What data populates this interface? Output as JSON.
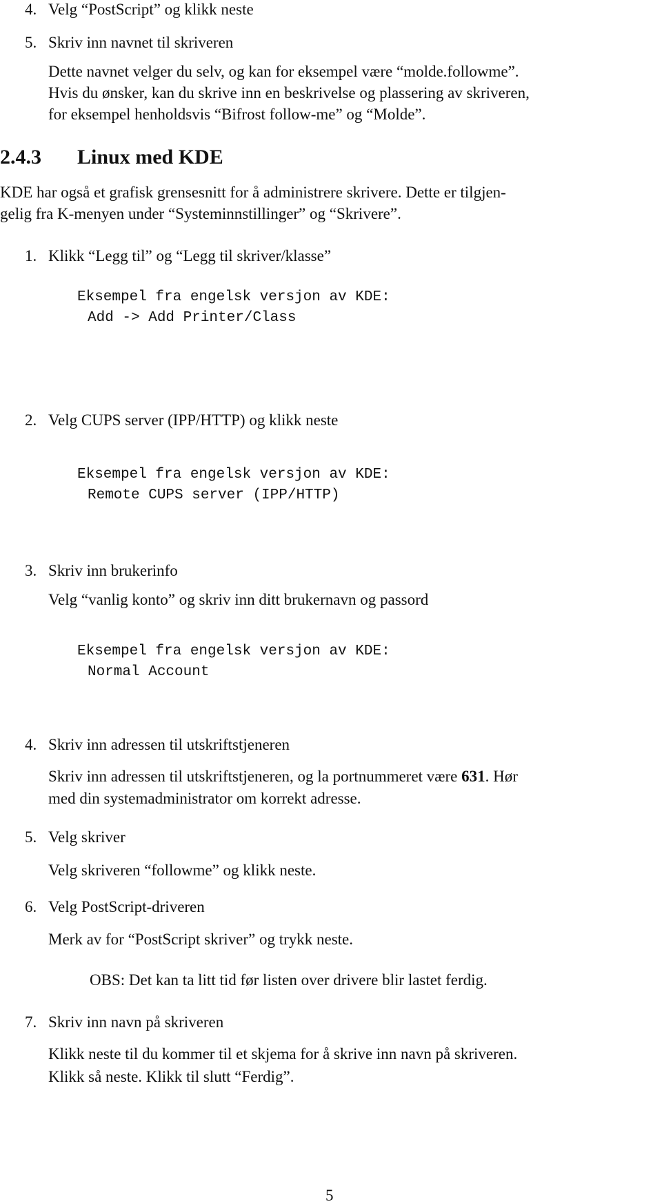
{
  "prev_list": [
    {
      "number": "4.",
      "title": "Velg “PostScript” og klikk neste"
    },
    {
      "number": "5.",
      "title": "Skriv inn navnet til skriveren",
      "body": [
        "Dette navnet velger du selv, og kan for eksempel være “molde.followme”.",
        "Hvis du ønsker, kan du skrive inn en beskrivelse og plassering av skriveren,",
        "for eksempel henholdsvis “Bifrost follow-me” og “Molde”."
      ]
    }
  ],
  "section": {
    "number": "2.4.3",
    "title": "Linux med KDE",
    "intro": [
      "KDE har også et grafisk grensesnitt for å administrere skrivere. Dette er tilgjen-",
      "gelig fra K-menyen under “Systeminnstillinger” og “Skrivere”."
    ]
  },
  "steps": [
    {
      "number": "1.",
      "title": "Klikk “Legg til” og “Legg til skriver/klasse”",
      "example_label": "Eksempel fra engelsk versjon av KDE:",
      "example_value": "Add -> Add Printer/Class"
    },
    {
      "number": "2.",
      "title": "Velg CUPS server (IPP/HTTP) og klikk neste",
      "example_label": "Eksempel fra engelsk versjon av KDE:",
      "example_value": "Remote CUPS server (IPP/HTTP)"
    },
    {
      "number": "3.",
      "title": "Skriv inn brukerinfo",
      "body": [
        "Velg “vanlig konto” og skriv inn ditt brukernavn og passord"
      ],
      "example_label": "Eksempel fra engelsk versjon av KDE:",
      "example_value": "Normal Account"
    },
    {
      "number": "4.",
      "title": "Skriv inn adressen til utskriftstjeneren",
      "body_line1_pre": "Skriv inn adressen til utskriftstjeneren, og la portnummeret være ",
      "body_line1_bold": "631",
      "body_line1_post": ". Hør",
      "body_line2": "med din systemadministrator om korrekt adresse."
    },
    {
      "number": "5.",
      "title": "Velg skriver",
      "body": [
        "Velg skriveren “followme” og klikk neste."
      ]
    },
    {
      "number": "6.",
      "title": "Velg PostScript-driveren",
      "body": [
        "Merk av for “PostScript skriver” og trykk neste."
      ],
      "note": "OBS: Det kan ta litt tid før listen over drivere blir lastet ferdig."
    },
    {
      "number": "7.",
      "title": "Skriv inn navn på skriveren",
      "body": [
        "Klikk neste til du kommer til et skjema for å skrive inn navn på skriveren.",
        "Klikk så neste. Klikk til slutt “Ferdig”."
      ]
    }
  ],
  "page_number": "5"
}
